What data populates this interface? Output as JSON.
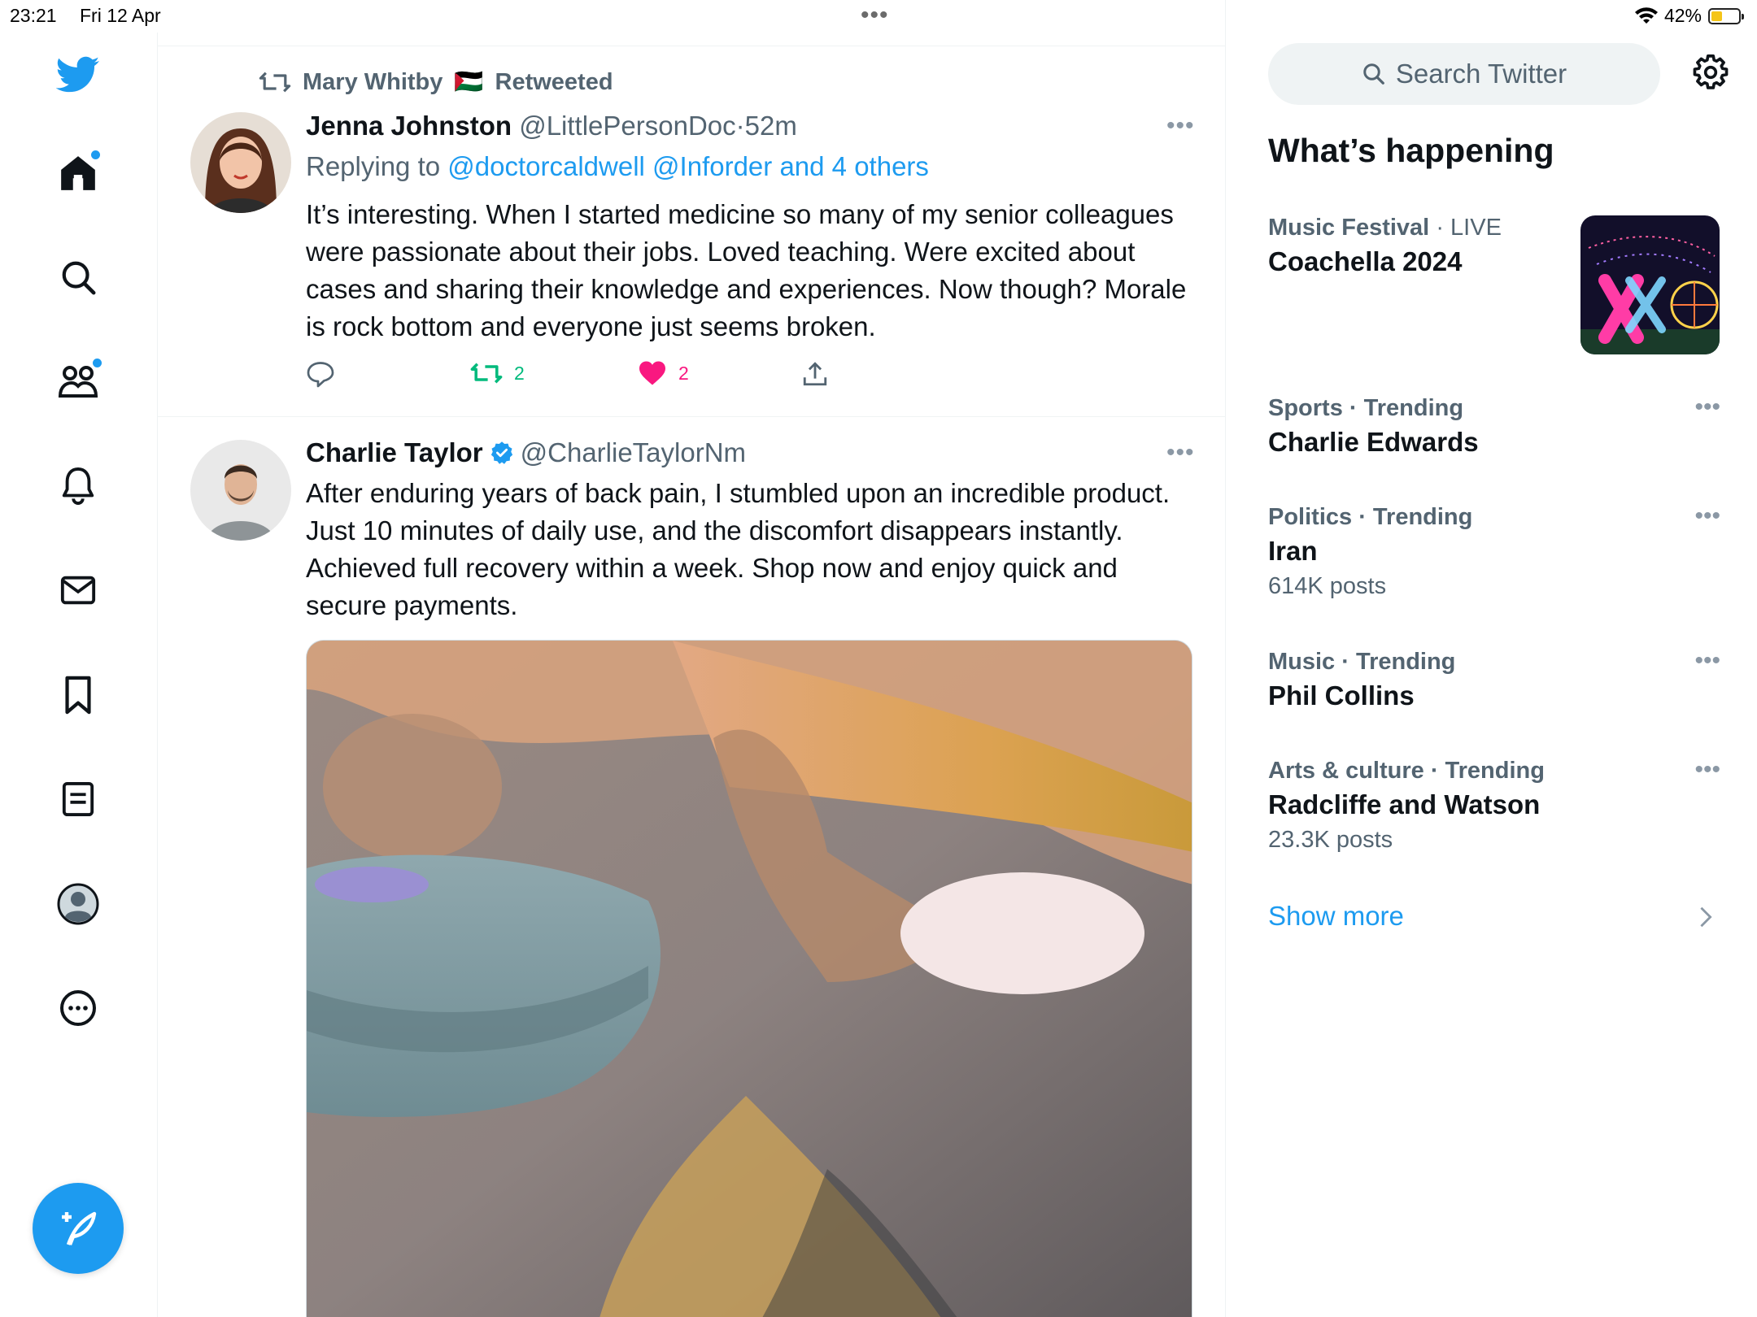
{
  "status_bar": {
    "time": "23:21",
    "date": "Fri 12 Apr",
    "battery": "42%",
    "battery_level": 0.42
  },
  "nav": {
    "items": [
      {
        "name": "home",
        "badge": true
      },
      {
        "name": "explore"
      },
      {
        "name": "communities",
        "badge": true
      },
      {
        "name": "notifications"
      },
      {
        "name": "messages"
      },
      {
        "name": "bookmarks"
      },
      {
        "name": "lists"
      },
      {
        "name": "profile"
      },
      {
        "name": "more"
      }
    ],
    "compose": "compose-tweet"
  },
  "timeline": {
    "tweets": [
      {
        "retweeted_by": "Mary Whitby",
        "retweeted_flag": "🇵🇸",
        "retweeted_label": "Retweeted",
        "author": "Jenna Johnston",
        "handle": "@LittlePersonDoc",
        "sep": "·",
        "time": "52m",
        "replying_prefix": "Replying to",
        "replying_to": "@doctorcaldwell @Inforder and 4 others",
        "text": "It’s interesting. When I started medicine so many of my senior colleagues were passionate about their jobs. Loved teaching. Were excited about cases and sharing their knowledge and experiences. Now though? Morale is rock bottom and everyone just seems broken.",
        "retweets": "2",
        "likes": "2"
      },
      {
        "author": "Charlie Taylor",
        "verified": true,
        "handle": "@CharlieTaylorNm",
        "text": "After enduring years of back pain, I stumbled upon an incredible product. Just 10 minutes of daily use, and the discomfort disappears instantly. Achieved full recovery within a week. Shop now and enjoy quick and secure payments."
      }
    ]
  },
  "sidebar": {
    "search_placeholder": "Search Twitter",
    "section_title": "What’s happening",
    "featured": {
      "category": "Music Festival",
      "sep": "·",
      "status": "LIVE",
      "title": "Coachella 2024"
    },
    "trends": [
      {
        "category": "Sports · Trending",
        "name": "Charlie Edwards",
        "posts": ""
      },
      {
        "category": "Politics · Trending",
        "name": "Iran",
        "posts": "614K posts"
      },
      {
        "category": "Music · Trending",
        "name": "Phil Collins",
        "posts": ""
      },
      {
        "category": "Arts & culture · Trending",
        "name": "Radcliffe and Watson",
        "posts": "23.3K posts"
      }
    ],
    "show_more": "Show more"
  },
  "colors": {
    "accent": "#1d9bf0",
    "retweet": "#00ba7c",
    "like": "#f91880",
    "muted": "#536471"
  }
}
